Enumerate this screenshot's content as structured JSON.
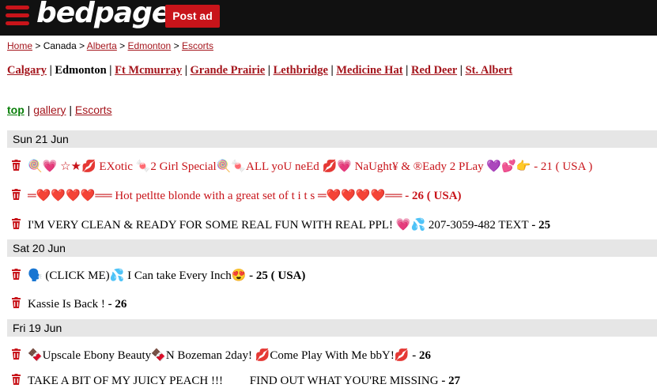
{
  "header": {
    "logo": "bedpage",
    "post_ad": "Post ad"
  },
  "breadcrumb": {
    "home": "Home",
    "sep1": ">",
    "country": "Canada",
    "sep2": ">",
    "province": "Alberta",
    "sep3": ">",
    "city": "Edmonton",
    "sep4": ">",
    "category": "Escorts"
  },
  "cities": [
    "Calgary",
    "Edmonton",
    "Ft Mcmurray",
    "Grande Prairie",
    "Lethbridge",
    "Medicine Hat",
    "Red Deer",
    "St. Albert"
  ],
  "current_city": "Edmonton",
  "subnav": {
    "top": "top",
    "gallery": "gallery",
    "escorts": "Escorts",
    "sep": "|"
  },
  "days": [
    {
      "label": "Sun 21 Jun"
    },
    {
      "label": "Sat 20 Jun"
    },
    {
      "label": "Fri 19 Jun"
    }
  ],
  "listings": [
    {
      "text": "🍭💗 ☆★💋 EXotic 🍬2 Girl Special🍭🍬ALL yoU neEd 💋💗 NaUght¥ & ®Eady 2 PLay 💜💕👉",
      "age": " - 21 ( USA )",
      "color": "#c8141a"
    },
    {
      "text": "═❤️❤️❤️❤️══ Hot petltte blonde with a great set of t i t s ═❤️❤️❤️❤️══",
      "age": " - 26 ( USA)",
      "color": "#c8141a"
    },
    {
      "text": "I'M VERY CLEAN & READY FOR SOME REAL FUN WITH REAL PPL! 💗💦 207-3059-482 TEXT",
      "age": " - 25",
      "color": "#000000"
    },
    {
      "text": "🗣️ (CLICK ME)💦 I Can take Every Inch😍",
      "age": " - 25 ( USA)",
      "color": "#000000"
    },
    {
      "text": "Kassie Is Back !",
      "age": " - 26",
      "color": "#000000"
    },
    {
      "text": "🍫Upscale Ebony Beauty🍫N Bozeman 2day! 💋Come Play With Me bbY!💋",
      "age": " - 26",
      "color": "#000000"
    },
    {
      "text": "TAKE A BIT OF MY JUICY PEACH !!!         FIND OUT WHAT YOU'RE MISSING",
      "age": " - 27",
      "color": "#000000"
    }
  ],
  "colors": {
    "brand": "#c8141a",
    "topbar": "#111111",
    "link": "#a4151c",
    "top_link": "#0a7f0a",
    "day_header_bg": "#e6e6e6"
  }
}
